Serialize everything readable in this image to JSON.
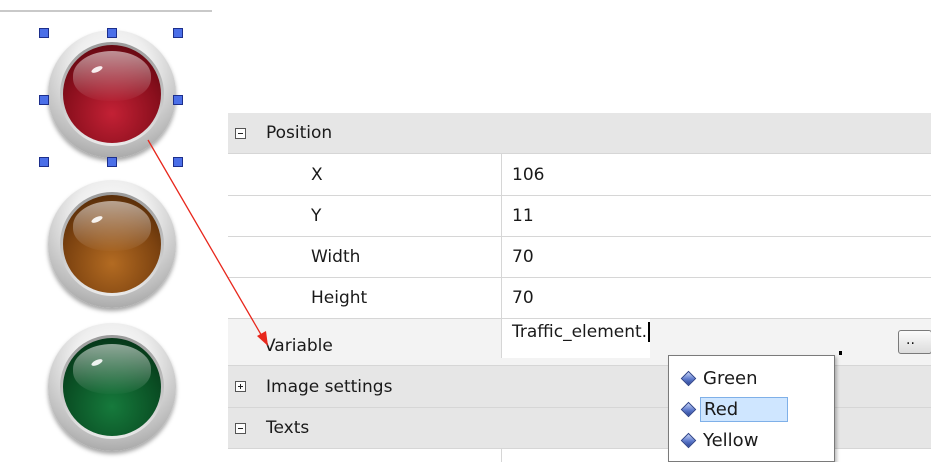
{
  "colors": {
    "selection_handle": "#4b6fe8",
    "arrow": "#e8271c",
    "section_bg": "#e6e6e6",
    "dropdown_selected_bg": "#cfe6ff"
  },
  "canvas": {
    "lamps": [
      {
        "name": "red-light",
        "color": "#8a0f1d",
        "selected": true
      },
      {
        "name": "yellow-light",
        "color": "#7d4310",
        "selected": false
      },
      {
        "name": "green-light",
        "color": "#0a4f24",
        "selected": false
      }
    ]
  },
  "properties": {
    "position": {
      "label": "Position",
      "expander": "minus",
      "x": {
        "label": "X",
        "value": "106"
      },
      "y": {
        "label": "Y",
        "value": "11"
      },
      "width": {
        "label": "Width",
        "value": "70"
      },
      "height": {
        "label": "Height",
        "value": "70"
      }
    },
    "variable": {
      "label": "Variable",
      "value": "Traffic_element.",
      "button_label": ".."
    },
    "image_settings": {
      "label": "Image settings",
      "expander": "plus"
    },
    "texts": {
      "label": "Texts",
      "expander": "minus"
    }
  },
  "autocomplete": {
    "items": [
      {
        "label": "Green",
        "icon": "member-icon",
        "selected": false
      },
      {
        "label": "Red",
        "icon": "member-icon",
        "selected": true
      },
      {
        "label": "Yellow",
        "icon": "member-icon",
        "selected": false
      }
    ]
  }
}
